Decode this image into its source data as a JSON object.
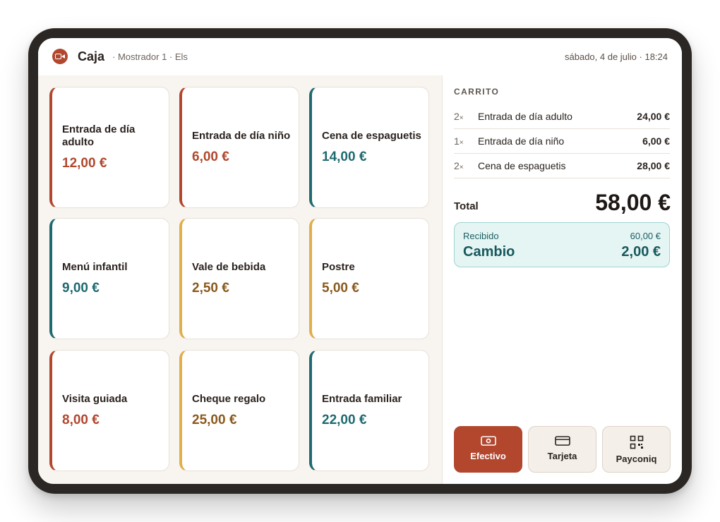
{
  "header": {
    "title": "Caja",
    "subtitle": "· Mostrador 1 · Els",
    "datetime": "sábado, 4 de julio · 18:24"
  },
  "products": [
    {
      "name": "Entrada de día adulto",
      "price": "12,00 €",
      "color": "#b2472e"
    },
    {
      "name": "Entrada de día niño",
      "price": "6,00 €",
      "color": "#b2472e"
    },
    {
      "name": "Cena de espaguetis",
      "price": "14,00 €",
      "color": "#1f6a70"
    },
    {
      "name": "Menú infantil",
      "price": "9,00 €",
      "color": "#1f6a70"
    },
    {
      "name": "Vale de bebida",
      "price": "2,50 €",
      "color": "#e2ad4b"
    },
    {
      "name": "Postre",
      "price": "5,00 €",
      "color": "#e2ad4b"
    },
    {
      "name": "Visita guiada",
      "price": "8,00 €",
      "color": "#b2472e"
    },
    {
      "name": "Cheque regalo",
      "price": "25,00 €",
      "color": "#e2ad4b"
    },
    {
      "name": "Entrada familiar",
      "price": "22,00 €",
      "color": "#1f6a70"
    }
  ],
  "cart": {
    "title": "CARRITO",
    "items": [
      {
        "qty": "2",
        "name": "Entrada de día adulto",
        "amount": "24,00 €"
      },
      {
        "qty": "1",
        "name": "Entrada de día niño",
        "amount": "6,00 €"
      },
      {
        "qty": "2",
        "name": "Cena de espaguetis",
        "amount": "28,00 €"
      }
    ],
    "qty_suffix": "×",
    "total_label": "Total",
    "total_value": "58,00 €"
  },
  "change": {
    "received_label": "Recibido",
    "received_value": "60,00 €",
    "change_label": "Cambio",
    "change_value": "2,00 €"
  },
  "payment": {
    "cash": "Efectivo",
    "card": "Tarjeta",
    "payconiq": "Payconiq",
    "selected": "cash",
    "icons": [
      "cash-icon",
      "card-icon",
      "qr-code-icon"
    ]
  },
  "colors": {
    "accent": "#b2472e",
    "teal": "#1f6a70",
    "gold": "#e2ad4b"
  }
}
